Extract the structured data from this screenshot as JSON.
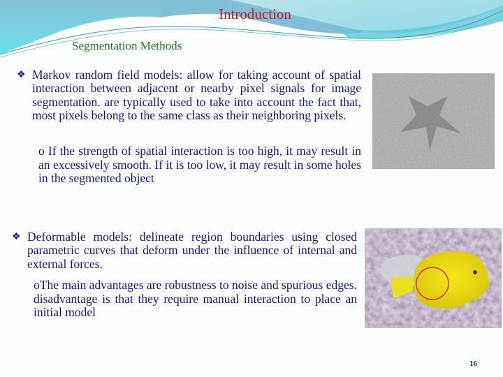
{
  "slide": {
    "title": "Introduction",
    "subtitle": "Segmentation Methods",
    "page_number": "16",
    "colors": {
      "title": "#c0191e",
      "subtitle": "#1e7a22",
      "body_text": "#16168a",
      "header_wave": "#7fc4d8",
      "accent_circle": "#d42a1a"
    }
  },
  "content": {
    "bullets": [
      {
        "icon": "diamond-bullet-icon",
        "text": "Markov random field models: allow for taking account of spatial interaction between adjacent or nearby pixel signals for image segmentation. are typically used to take into account the fact that, most pixels belong to the same class as their neighboring pixels.",
        "sub": "o If the strength of spatial interaction is too high, it may result in an excessively smooth. If it is too low, it may result in some holes in the segmented object"
      },
      {
        "icon": "diamond-bullet-icon",
        "text": "Deformable models: delineate region boundaries using closed parametric curves that deform under the influence of internal and external forces.",
        "sub": "oThe main advantages are robustness to noise and spurious edges. disadvantage is that they require manual interaction to place an initial model"
      }
    ]
  },
  "images": {
    "mrf_example": "noisy-star-image",
    "deformable_example": "yellow-fish-with-contour-image"
  }
}
